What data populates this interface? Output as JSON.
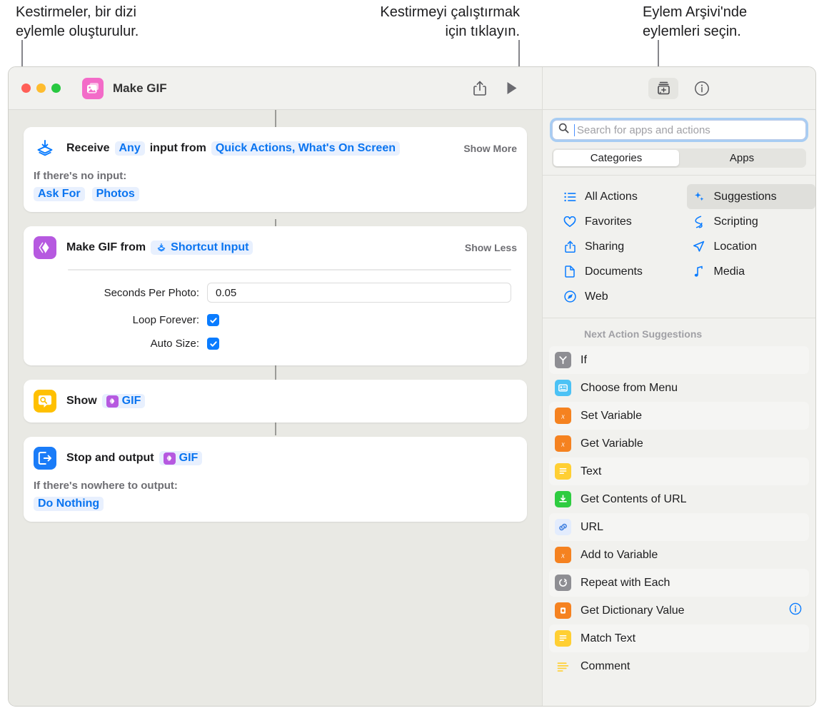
{
  "callouts": [
    {
      "id": "callout-1",
      "text": "Kestirmeler, bir dizi\neylemle oluşturulur."
    },
    {
      "id": "callout-2",
      "text": "Kestirmeyi çalıştırmak\niçin tıklayın."
    },
    {
      "id": "callout-3",
      "text": "Eylem Arşivi'nde\neylemleri seçin."
    }
  ],
  "titlebar": {
    "app_icon": "photos-stack-icon",
    "document_title": "Make GIF",
    "share_label": "share-icon",
    "run_label": "play-icon",
    "library_label": "action-library-icon",
    "info_label": "info-icon"
  },
  "canvas": {
    "actions": [
      {
        "icon": "receive-input-icon",
        "icon_color": "#0a7cff",
        "title": "Receive",
        "tokens": [
          "Any"
        ],
        "mid_text": "input from",
        "source_token": "Quick Actions, What's On Screen",
        "toggle": "Show More",
        "sub_label": "If there's no input:",
        "sub_tokens": [
          "Ask For",
          "Photos"
        ]
      },
      {
        "icon": "make-gif-icon",
        "icon_color": "#b659e0",
        "title": "Make GIF from",
        "input_token": "Shortcut Input",
        "toggle": "Show Less",
        "params": [
          {
            "label": "Seconds Per Photo:",
            "type": "text",
            "value": "0.05"
          },
          {
            "label": "Loop Forever:",
            "type": "checkbox",
            "checked": true
          },
          {
            "label": "Auto Size:",
            "type": "checkbox",
            "checked": true
          }
        ]
      },
      {
        "icon": "quick-look-icon",
        "icon_color": "#ffc000",
        "title": "Show",
        "var_token": "GIF"
      },
      {
        "icon": "stop-output-icon",
        "icon_color": "#1a7cf8",
        "title": "Stop and output",
        "var_token": "GIF",
        "sub_label": "If there's nowhere to output:",
        "sub_tokens": [
          "Do Nothing"
        ]
      }
    ]
  },
  "sidebar": {
    "search": {
      "placeholder": "Search for apps and actions",
      "value": "",
      "icon": "search-icon"
    },
    "segmented": {
      "options": [
        "Categories",
        "Apps"
      ],
      "selected": "Categories"
    },
    "categories_left": [
      {
        "label": "All Actions",
        "icon": "list-bullet-icon",
        "selected": false
      },
      {
        "label": "Favorites",
        "icon": "heart-icon",
        "selected": false
      },
      {
        "label": "Sharing",
        "icon": "share-icon",
        "selected": false
      },
      {
        "label": "Documents",
        "icon": "document-icon",
        "selected": false
      },
      {
        "label": "Web",
        "icon": "safari-compass-icon",
        "selected": false
      }
    ],
    "categories_right": [
      {
        "label": "Suggestions",
        "icon": "sparkles-icon",
        "selected": true
      },
      {
        "label": "Scripting",
        "icon": "scripting-icon",
        "selected": false
      },
      {
        "label": "Location",
        "icon": "location-arrow-icon",
        "selected": false
      },
      {
        "label": "Media",
        "icon": "music-note-icon",
        "selected": false
      }
    ],
    "suggestions_header": "Next Action Suggestions",
    "suggestions": [
      {
        "label": "If",
        "icon": "branch-icon",
        "icon_color": "#8e8e93",
        "alt": true,
        "info": false
      },
      {
        "label": "Choose from Menu",
        "icon": "menu-icon",
        "icon_color": "#4cc2f5",
        "alt": false,
        "info": false
      },
      {
        "label": "Set Variable",
        "icon": "variable-icon",
        "icon_color": "#f58220",
        "alt": true,
        "info": false
      },
      {
        "label": "Get Variable",
        "icon": "variable-icon",
        "icon_color": "#f58220",
        "alt": false,
        "info": false
      },
      {
        "label": "Text",
        "icon": "text-icon",
        "icon_color": "#ffcf33",
        "alt": true,
        "info": false
      },
      {
        "label": "Get Contents of URL",
        "icon": "download-icon",
        "icon_color": "#2ecc40",
        "alt": false,
        "info": false
      },
      {
        "label": "URL",
        "icon": "link-icon",
        "icon_color": "#e3ecfd",
        "alt": true,
        "info": false
      },
      {
        "label": "Add to Variable",
        "icon": "variable-icon",
        "icon_color": "#f58220",
        "alt": false,
        "info": false
      },
      {
        "label": "Repeat with Each",
        "icon": "repeat-icon",
        "icon_color": "#8e8e93",
        "alt": true,
        "info": false
      },
      {
        "label": "Get Dictionary Value",
        "icon": "dictionary-icon",
        "icon_color": "#f58220",
        "alt": false,
        "info": true
      },
      {
        "label": "Match Text",
        "icon": "text-icon",
        "icon_color": "#ffcf33",
        "alt": true,
        "info": false
      },
      {
        "label": "Comment",
        "icon": "comment-lines-icon",
        "icon_color": "#ffcf33",
        "alt": false,
        "info": false
      }
    ]
  },
  "colors": {
    "accent_blue": "#0a7cff",
    "token_bg": "#e8f0fe",
    "canvas_bg": "#e9e9e4",
    "chrome_bg": "#f1f1ee"
  }
}
